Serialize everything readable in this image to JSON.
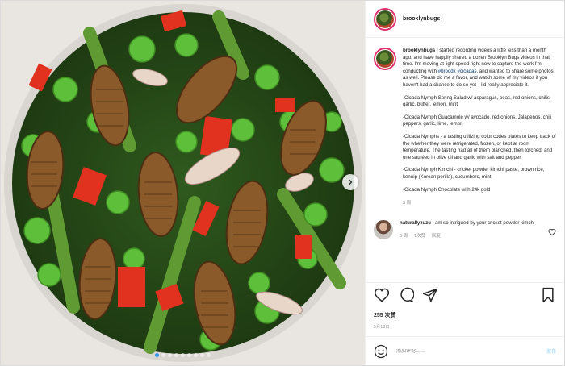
{
  "profile": {
    "username": "brooklynbugs"
  },
  "caption": {
    "username": "brooklynbugs",
    "intro_before_tags": "I started recording videos a little less than a month ago, and have happily shared a dozen Brooklyn Bugs videos in that time. I'm moving at light speed right now to capture the work I'm conducting with ",
    "tag1": "#broodx",
    "tag2": "#cicadas",
    "intro_after_tags": ", and wanted to share some photos as well. Please do me a favor, and watch some of my videos if you haven't had a chance to do so yet—I'd really appreciate it.",
    "items": [
      "-Cicada Nymph Spring Salad w/ asparagus, peas, red onions, chilis, garlic, butter, lemon, mint",
      "-Cicada Nymph Guacamole w/ avocado, red onions, Jalapenos, chili peppers, garlic, lime, lemon",
      "-Cicada Nymphs - a tasting utilizing color codes plates to keep track of the whether they were refrigerated, frozen, or kept at room temperature. The tasting had all of them blanched, then torched, and one sautéed in olive oil and garlic with salt and pepper.",
      "-Cicada Nymph Kimchi - cricket powder kimchi paste, brown rice, kennip (Korean perilla), cucumbers, mint",
      "-Cicada Nymph Chocolate with 24k gold"
    ],
    "age": "3 周"
  },
  "comment": {
    "username": "naturallyzuzu",
    "text": "I am so intrigued by your cricket powder kimchi",
    "age": "3 周",
    "likes": "1次赞",
    "reply_label": "回复"
  },
  "post": {
    "likes": "255 次赞",
    "date": "5月18日"
  },
  "add_comment": {
    "placeholder": "添加评论……",
    "post_label": "发布"
  },
  "carousel": {
    "dot_count": 9,
    "active_index": 0
  },
  "colors": {
    "accent": "#3897f0",
    "link": "#00376b",
    "meta": "#8e8e8e",
    "story_ring": "#e1306c"
  }
}
